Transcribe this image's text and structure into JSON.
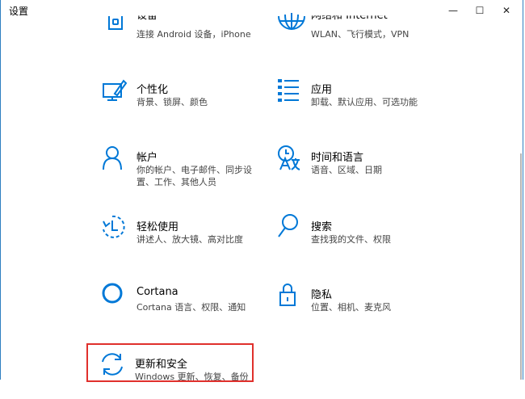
{
  "window": {
    "title": "设置",
    "minimize_glyph": "—",
    "maximize_glyph": "☐",
    "close_glyph": "✕"
  },
  "accent_color": "#0078d7",
  "highlight_color": "#e0302c",
  "items": [
    {
      "name": "设备",
      "desc": "连接 Android 设备，iPhone",
      "icon": "phone-icon"
    },
    {
      "name": "网络和 Internet",
      "desc": "WLAN、飞行模式，VPN",
      "icon": "globe-icon"
    },
    {
      "name": "个性化",
      "desc": "背景、锁屏、颜色",
      "icon": "personalization-icon"
    },
    {
      "name": "应用",
      "desc": "卸载、默认应用、可选功能",
      "icon": "apps-list-icon"
    },
    {
      "name": "帐户",
      "desc": "你的帐户、电子邮件、同步设置、工作、其他人员",
      "icon": "person-icon"
    },
    {
      "name": "时间和语言",
      "desc": "语音、区域、日期",
      "icon": "time-language-icon"
    },
    {
      "name": "轻松使用",
      "desc": "讲述人、放大镜、高对比度",
      "icon": "ease-of-access-icon"
    },
    {
      "name": "搜索",
      "desc": "查找我的文件、权限",
      "icon": "search-icon"
    },
    {
      "name": "Cortana",
      "desc": "Cortana 语言、权限、通知",
      "icon": "cortana-icon"
    },
    {
      "name": "隐私",
      "desc": "位置、相机、麦克风",
      "icon": "lock-icon"
    },
    {
      "name": "更新和安全",
      "desc": "Windows 更新、恢复、备份",
      "icon": "update-icon"
    }
  ]
}
